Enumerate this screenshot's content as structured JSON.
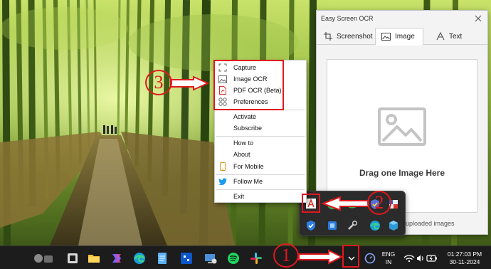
{
  "context_menu": {
    "items": [
      {
        "label": "Capture",
        "icon": "capture-icon"
      },
      {
        "label": "Image OCR",
        "icon": "image-icon"
      },
      {
        "label": "PDF OCR (Beta)",
        "icon": "pdf-icon"
      },
      {
        "label": "Preferences",
        "icon": "grid-icon"
      },
      {
        "label": "Activate"
      },
      {
        "label": "Subscribe"
      },
      {
        "label": "How to"
      },
      {
        "label": "About"
      },
      {
        "label": "For Mobile",
        "icon": "mobile-icon"
      },
      {
        "label": "Follow Me",
        "icon": "twitter-icon"
      },
      {
        "label": "Exit"
      }
    ]
  },
  "app_window": {
    "title": "Easy Screen OCR",
    "tabs": [
      {
        "label": "Screenshot",
        "icon": "crop-icon"
      },
      {
        "label": "Image",
        "icon": "image-icon",
        "active": true
      },
      {
        "label": "Text",
        "icon": "text-icon"
      }
    ],
    "drop_zone_text": "Drag one Image Here",
    "uploaded_text": "any uploaded images"
  },
  "taskbar": {
    "lang_line1": "ENG",
    "lang_line2": "IN",
    "time": "01:27:03 PM",
    "date": "30-11-2024",
    "overflow_icon": "chevron-up-icon"
  },
  "annotations": {
    "step1": "1",
    "step2": "2",
    "step3": "3",
    "color": "#e0181e"
  },
  "colors": {
    "taskbar_bg": "#1c1c1c",
    "flyout_bg": "#2b2b2b",
    "twitter_blue": "#1d9bf0",
    "pdf_red": "#d9342b"
  }
}
